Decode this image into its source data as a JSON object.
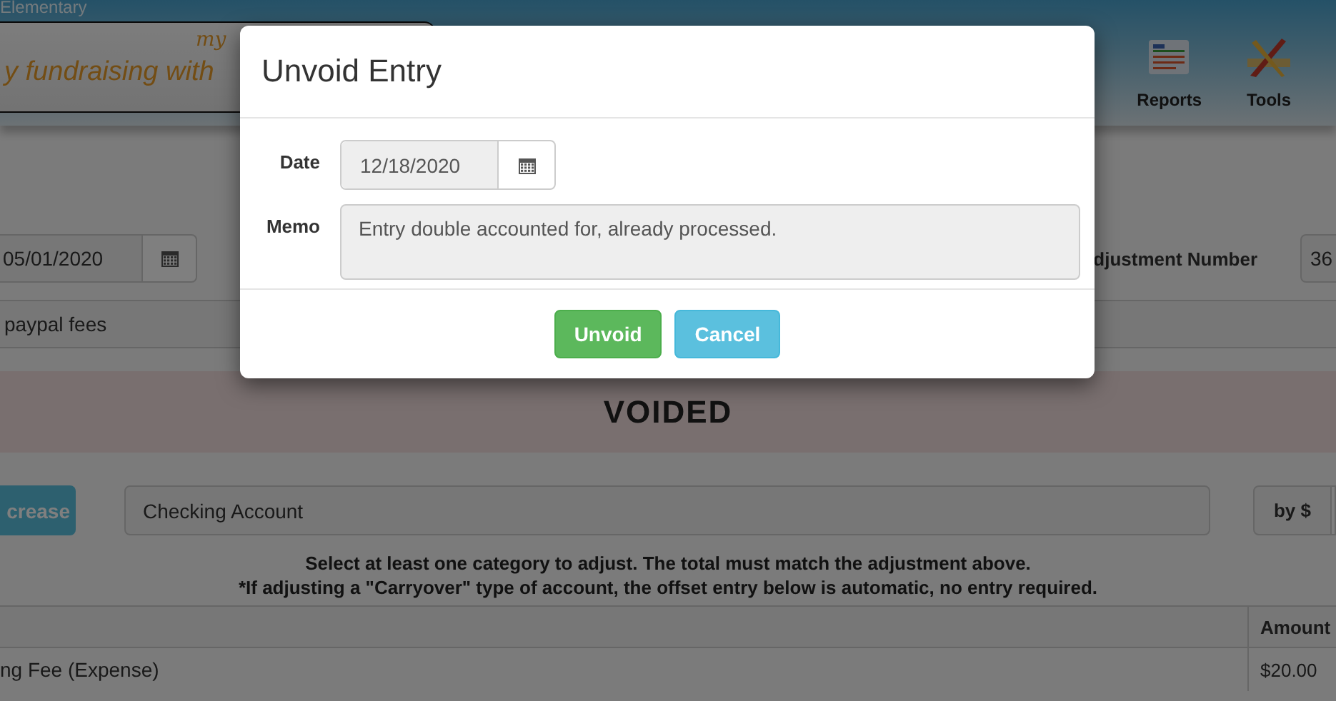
{
  "header": {
    "school": "Elementary",
    "tagline": "y fundraising with",
    "logo_text": "my",
    "nav": [
      {
        "label": "Reports",
        "kind": "reports"
      },
      {
        "label": "Tools",
        "kind": "tools"
      }
    ]
  },
  "form": {
    "date": "05/01/2020",
    "adjustment_label": "djustment Number",
    "adjustment_number": "36",
    "memo": "paypal fees"
  },
  "status_banner": "VOIDED",
  "adjustment": {
    "direction_button": "crease",
    "account": "Checking Account",
    "by_label": "by $"
  },
  "instructions": [
    "Select at least one category to adjust. The total must match the adjustment above.",
    "*If adjusting a \"Carryover\" type of account, the offset entry below is automatic, no entry required."
  ],
  "table": {
    "amount_header": "Amount",
    "rows": [
      {
        "category": "ng Fee (Expense)",
        "amount": "$20.00"
      }
    ]
  },
  "dialog": {
    "title": "Unvoid Entry",
    "fields": [
      {
        "label": "Date",
        "value": "12/18/2020",
        "kind": "date"
      },
      {
        "label": "Memo",
        "value": "Entry double accounted for, already processed.",
        "kind": "textarea"
      }
    ],
    "buttons": [
      {
        "label": "Unvoid",
        "kind": "primary"
      },
      {
        "label": "Cancel",
        "kind": "secondary"
      }
    ]
  }
}
